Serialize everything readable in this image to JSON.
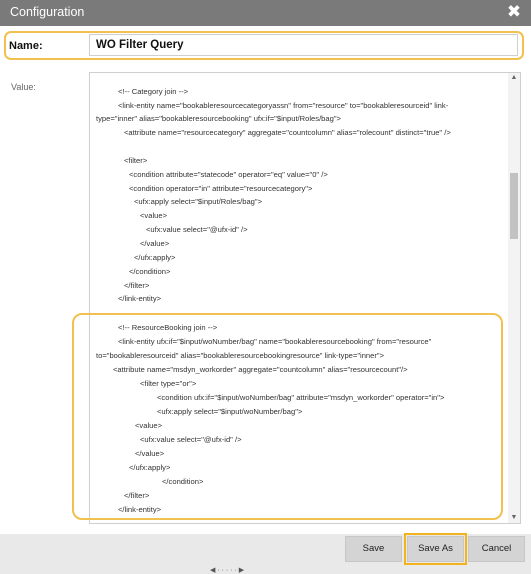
{
  "window": {
    "title": "Configuration",
    "close_icon": "close-icon (✖)"
  },
  "form": {
    "name_label": "Name:",
    "name_value": "WO Filter Query",
    "value_label": "Value:"
  },
  "code": {
    "lines": [
      "<!-- Category join -->",
      "<link-entity name=\"bookableresourcecategoryassn\" from=\"resource\" to=\"bookableresourceid\" link-",
      "type=\"inner\" alias=\"bookableresourcebooking\" ufx:if=\"$input/Roles/bag\">",
      "<attribute name=\"resourcecategory\" aggregate=\"countcolumn\" alias=\"rolecount\" distinct=\"true\" />",
      "<filter>",
      "<condition attribute=\"statecode\" operator=\"eq\" value=\"0\" />",
      "<condition operator=\"in\" attribute=\"resourcecategory\">",
      "<ufx:apply select=\"$input/Roles/bag\">",
      "<value>",
      "<ufx:value select=\"@ufx-id\" />",
      "</value>",
      "</ufx:apply>",
      "</condition>",
      "</filter>",
      "</link-entity>",
      "<!-- ResourceBooking join -->",
      "<link-entity ufx:if=\"$input/woNumber/bag\"  name=\"bookableresourcebooking\" from=\"resource\"",
      "to=\"bookableresourceid\" alias=\"bookableresourcebookingresource\" link-type=\"inner\">",
      "<attribute name=\"msdyn_workorder\" aggregate=\"countcolumn\" alias=\"resourcecount\"/>",
      "<filter type=\"or\">",
      "<condition ufx:if=\"$input/woNumber/bag\" attribute=\"msdyn_workorder\" operator=\"in\">",
      "<ufx:apply select=\"$input/woNumber/bag\">",
      "<value>",
      "<ufx:value select=\"@ufx-id\" />",
      "</value>",
      "</ufx:apply>",
      "</condition>",
      "</filter>",
      "</link-entity>"
    ]
  },
  "buttons": {
    "save": "Save",
    "save_as": "Save As",
    "cancel": "Cancel"
  },
  "colors": {
    "title_bar": "#7a7a7a",
    "highlight": "#f2c04f",
    "button_bg": "#d4d4d4"
  },
  "bottom_peek": "◀  ·  ·  ·  ·  ·  ▶"
}
